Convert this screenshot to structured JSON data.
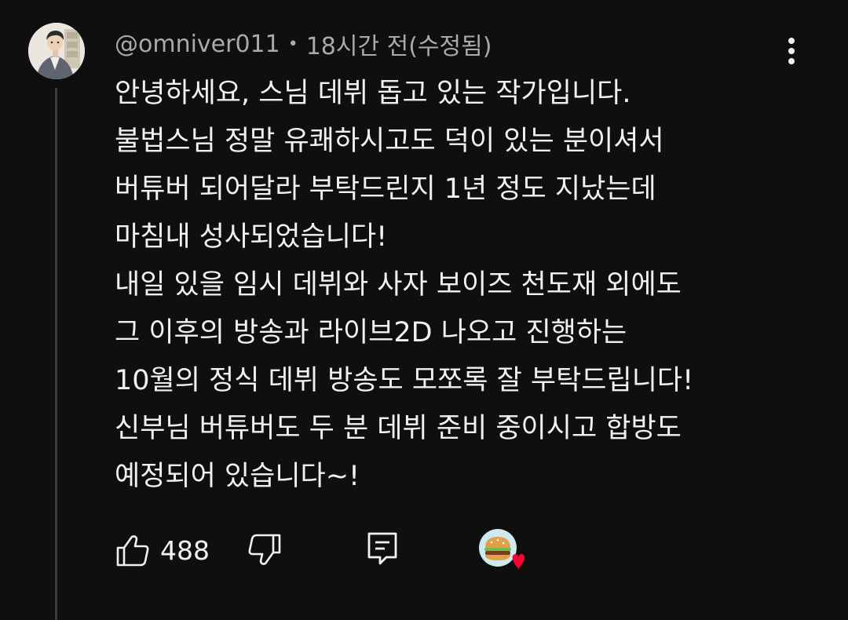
{
  "comment": {
    "author": "@omniver011",
    "separator": "•",
    "time": "18시간 전(수정됨)",
    "lines": [
      "안녕하세요, 스님 데뷔 돕고 있는 작가입니다.",
      "불법스님 정말 유쾌하시고도 덕이 있는 분이셔서",
      "버튜버 되어달라 부탁드린지 1년 정도 지났는데",
      "마침내 성사되었습니다!",
      "내일 있을 임시 데뷔와 사자 보이즈 천도재 외에도",
      "그 이후의 방송과 라이브2D 나오고 진행하는",
      "10월의 정식 데뷔 방송도 모쪼록 잘 부탁드립니다!",
      "신부님 버튜버도 두 분 데뷔 준비 중이시고 합방도",
      "예정되어 있습니다~!"
    ],
    "like_count": "488"
  },
  "icons": {
    "like": "thumbs-up-icon",
    "dislike": "thumbs-down-icon",
    "reply": "reply-icon",
    "more": "more-vertical-icon",
    "heart": "creator-heart-icon"
  },
  "colors": {
    "background": "#0f0f0f",
    "text": "#f1f1f1",
    "meta": "#aaaaaa",
    "heart": "#ff0033",
    "thread_line": "#3a3a3a"
  }
}
